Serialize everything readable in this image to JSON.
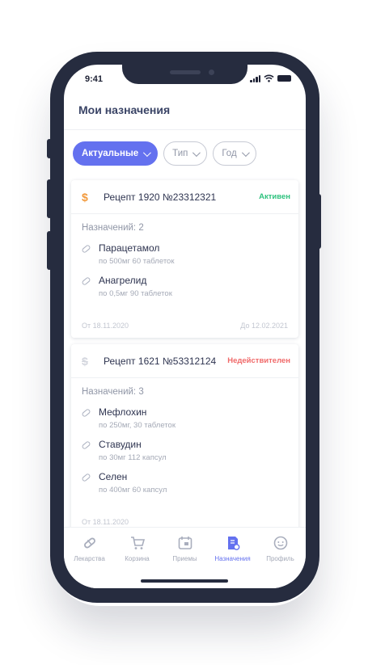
{
  "status_bar": {
    "time": "9:41"
  },
  "header": {
    "title": "Мои назначения"
  },
  "filters": [
    {
      "label": "Актуальные",
      "active": true
    },
    {
      "label": "Тип",
      "active": false
    },
    {
      "label": "Год",
      "active": false
    }
  ],
  "prescriptions": [
    {
      "icon": "dollar-icon",
      "title": "Рецепт 1920 №23312321",
      "status": "Активен",
      "status_color": "#2ec27e",
      "count_label": "Назначений: 2",
      "meds": [
        {
          "name": "Парацетамол",
          "dose": "по 500мг 60 таблеток"
        },
        {
          "name": "Анагрелид",
          "dose": "по 0,5мг 90 таблеток"
        }
      ],
      "from": "От 18.11.2020",
      "to": "До 12.02.2021"
    },
    {
      "icon": "dollar-crossed-icon",
      "title": "Рецепт 1621 №53312124",
      "status": "Недействителен",
      "status_color": "#f06a6a",
      "count_label": "Назначений: 3",
      "meds": [
        {
          "name": "Мефлохин",
          "dose": "по 250мг, 30 таблеток"
        },
        {
          "name": "Ставудин",
          "dose": "по 30мг 112 капсул"
        },
        {
          "name": "Селен",
          "dose": "по 400мг 60 капсул"
        }
      ],
      "from": "От 18.11.2020",
      "to": ""
    }
  ],
  "tabbar": [
    {
      "label": "Лекарства",
      "icon": "pill-icon",
      "active": false
    },
    {
      "label": "Корзина",
      "icon": "cart-icon",
      "active": false
    },
    {
      "label": "Приемы",
      "icon": "calendar-icon",
      "active": false
    },
    {
      "label": "Назначения",
      "icon": "prescription-icon",
      "active": true
    },
    {
      "label": "Профиль",
      "icon": "profile-icon",
      "active": false
    }
  ],
  "colors": {
    "accent": "#6471ef",
    "frame": "#262c3f",
    "active_status": "#2ec27e",
    "invalid_status": "#f06a6a"
  }
}
